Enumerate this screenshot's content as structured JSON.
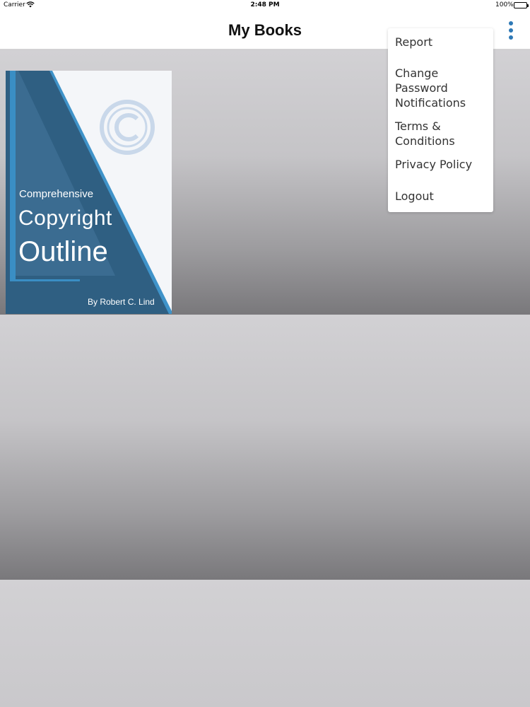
{
  "status_bar": {
    "carrier": "Carrier",
    "time": "2:48 PM",
    "battery": "100%"
  },
  "nav": {
    "title": "My Books",
    "menu_icon": "more-vertical-icon",
    "accent_color": "#2e79b6"
  },
  "books": [
    {
      "cover_line1": "Comprehensive",
      "cover_line2": "Copyright",
      "cover_line3": "Outline",
      "author": "By Robert C. Lind",
      "cover_icon": "copyright-icon"
    }
  ],
  "menu": {
    "items": [
      {
        "label": "Report"
      },
      {
        "label": "Change Password"
      },
      {
        "label": "Notifications"
      },
      {
        "label": "Terms &\nConditions"
      },
      {
        "label": "Privacy Policy"
      },
      {
        "label": "Logout"
      }
    ]
  }
}
